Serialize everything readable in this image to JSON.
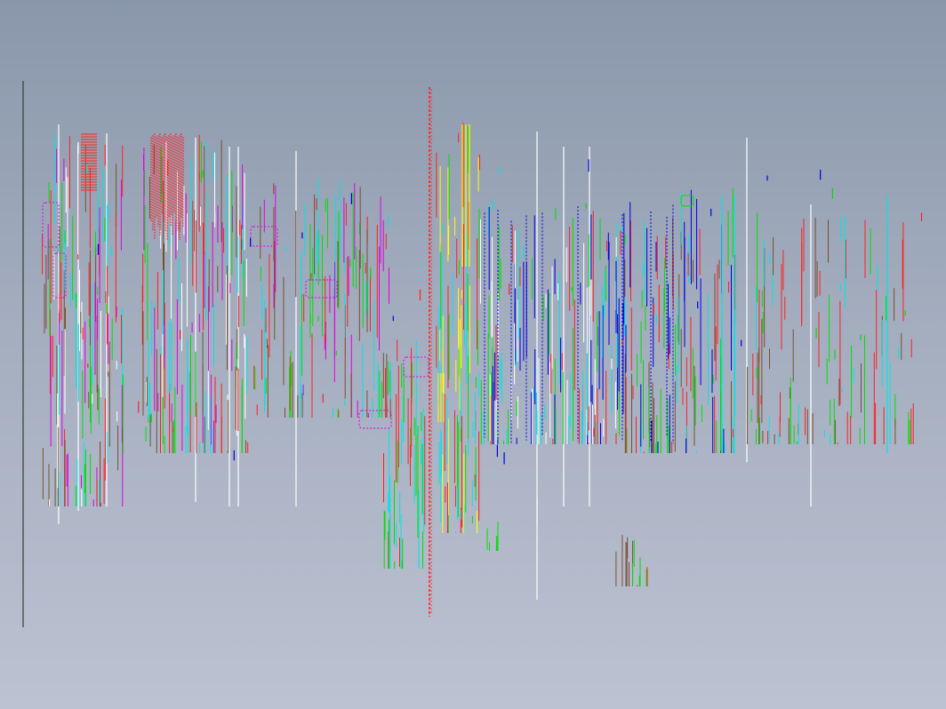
{
  "canvas": {
    "background_top": "#8a97ab",
    "background_bottom": "#bcc2d2"
  },
  "palette": {
    "white": "#ffffff",
    "red": "#ff2020",
    "green": "#00e000",
    "cyan": "#00e5e5",
    "blue": "#0000e0",
    "magenta": "#e000e0",
    "yellow": "#ffff00",
    "dark": "#3a3a3a",
    "brown": "#7a5030"
  }
}
